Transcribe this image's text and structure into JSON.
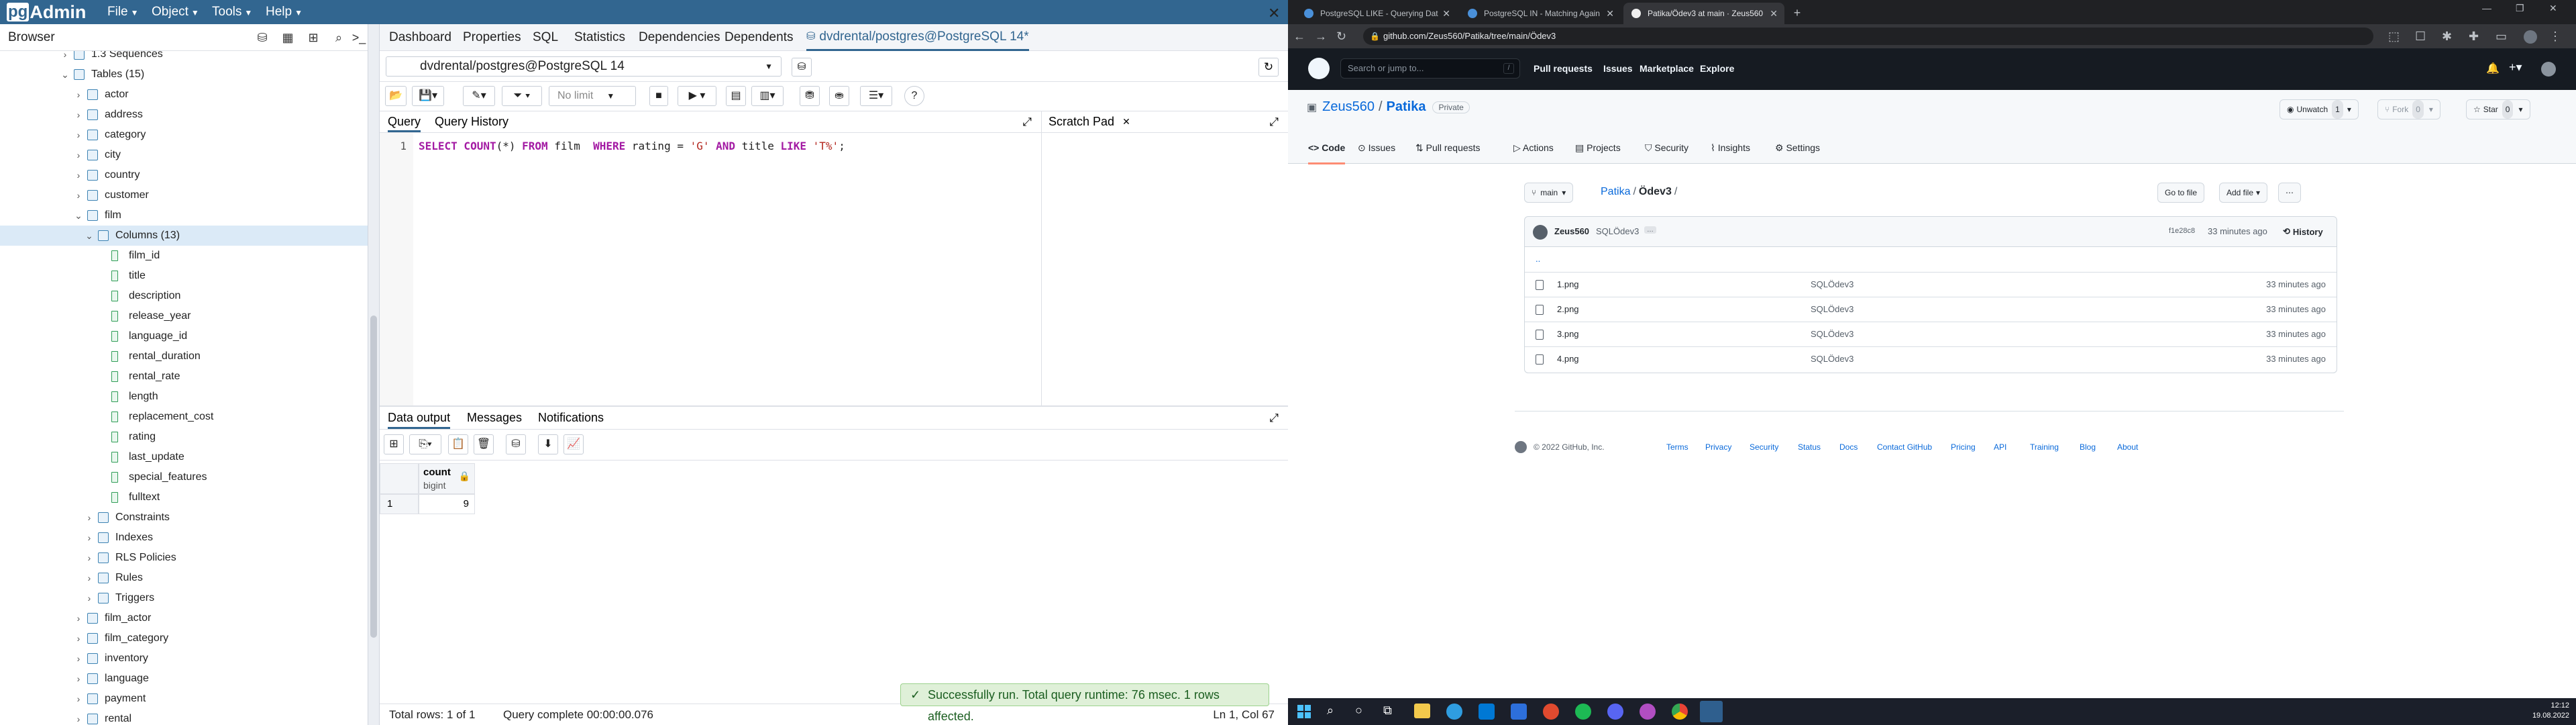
{
  "pgadmin": {
    "logo": {
      "pg": "pg",
      "rest": "Admin"
    },
    "menus": [
      "File",
      "Object",
      "Tools",
      "Help"
    ],
    "browser_title": "Browser",
    "tree": [
      {
        "label": "1.3 Sequences",
        "indent": 1,
        "icon": "sequence-icon",
        "expanded": false
      },
      {
        "label": "Tables (15)",
        "indent": 1,
        "icon": "tables-icon",
        "expanded": true
      },
      {
        "label": "actor",
        "indent": 2,
        "icon": "table-icon",
        "expanded": false
      },
      {
        "label": "address",
        "indent": 2,
        "icon": "table-icon",
        "expanded": false
      },
      {
        "label": "category",
        "indent": 2,
        "icon": "table-icon",
        "expanded": false
      },
      {
        "label": "city",
        "indent": 2,
        "icon": "table-icon",
        "expanded": false
      },
      {
        "label": "country",
        "indent": 2,
        "icon": "table-icon",
        "expanded": false
      },
      {
        "label": "customer",
        "indent": 2,
        "icon": "table-icon",
        "expanded": false
      },
      {
        "label": "film",
        "indent": 2,
        "icon": "table-icon",
        "expanded": true
      },
      {
        "label": "Columns (13)",
        "indent": 3,
        "icon": "columns-icon",
        "expanded": true,
        "selected": true
      },
      {
        "label": "film_id",
        "indent": 4,
        "icon": "column-icon"
      },
      {
        "label": "title",
        "indent": 4,
        "icon": "column-icon"
      },
      {
        "label": "description",
        "indent": 4,
        "icon": "column-icon"
      },
      {
        "label": "release_year",
        "indent": 4,
        "icon": "column-icon"
      },
      {
        "label": "language_id",
        "indent": 4,
        "icon": "column-icon"
      },
      {
        "label": "rental_duration",
        "indent": 4,
        "icon": "column-icon"
      },
      {
        "label": "rental_rate",
        "indent": 4,
        "icon": "column-icon"
      },
      {
        "label": "length",
        "indent": 4,
        "icon": "column-icon"
      },
      {
        "label": "replacement_cost",
        "indent": 4,
        "icon": "column-icon"
      },
      {
        "label": "rating",
        "indent": 4,
        "icon": "column-icon"
      },
      {
        "label": "last_update",
        "indent": 4,
        "icon": "column-icon"
      },
      {
        "label": "special_features",
        "indent": 4,
        "icon": "column-icon"
      },
      {
        "label": "fulltext",
        "indent": 4,
        "icon": "column-icon"
      },
      {
        "label": "Constraints",
        "indent": 3,
        "icon": "constraints-icon",
        "expanded": false
      },
      {
        "label": "Indexes",
        "indent": 3,
        "icon": "indexes-icon",
        "expanded": false
      },
      {
        "label": "RLS Policies",
        "indent": 3,
        "icon": "rls-icon",
        "expanded": false
      },
      {
        "label": "Rules",
        "indent": 3,
        "icon": "rules-icon",
        "expanded": false
      },
      {
        "label": "Triggers",
        "indent": 3,
        "icon": "triggers-icon",
        "expanded": false
      },
      {
        "label": "film_actor",
        "indent": 2,
        "icon": "table-icon",
        "expanded": false
      },
      {
        "label": "film_category",
        "indent": 2,
        "icon": "table-icon",
        "expanded": false
      },
      {
        "label": "inventory",
        "indent": 2,
        "icon": "table-icon",
        "expanded": false
      },
      {
        "label": "language",
        "indent": 2,
        "icon": "table-icon",
        "expanded": false
      },
      {
        "label": "payment",
        "indent": 2,
        "icon": "table-icon",
        "expanded": false
      },
      {
        "label": "rental",
        "indent": 2,
        "icon": "table-icon",
        "expanded": false
      }
    ],
    "tabs": [
      "Dashboard",
      "Properties",
      "SQL",
      "Statistics",
      "Dependencies",
      "Dependents"
    ],
    "query_tab_title": "dvdrental/postgres@PostgreSQL 14*",
    "connection": "dvdrental/postgres@PostgreSQL 14",
    "limit": "No limit",
    "query_tabs": {
      "query": "Query",
      "history": "Query History",
      "scratch": "Scratch Pad"
    },
    "line_number": "1",
    "sql": {
      "p1": "SELECT COUNT",
      "p2": "(*) ",
      "p3": "FROM",
      "p4": " film  ",
      "p5": "WHERE",
      "p6": " rating = ",
      "p7": "'G'",
      "p8": " ",
      "p9": "AND",
      "p10": " title ",
      "p11": "LIKE",
      "p12": " ",
      "p13": "'T%'",
      "p14": ";"
    },
    "output_tabs": [
      "Data output",
      "Messages",
      "Notifications"
    ],
    "grid": {
      "col_name": "count",
      "col_type": "bigint",
      "row_num": "1",
      "value": "9"
    },
    "status": {
      "rows": "Total rows: 1 of 1",
      "complete": "Query complete 00:00:00.076",
      "position": "Ln 1, Col 67"
    },
    "toast": "Successfully run. Total query runtime: 76 msec. 1 rows affected."
  },
  "chrome": {
    "tabs": [
      {
        "title": "PostgreSQL LIKE - Querying Dat",
        "active": false
      },
      {
        "title": "PostgreSQL IN - Matching Again",
        "active": false
      },
      {
        "title": "Patika/Ödev3 at main · Zeus560",
        "active": true
      }
    ],
    "url_host": "github.com",
    "url_path": "/Zeus560/Patika/tree/main/Ödev3"
  },
  "github": {
    "search_placeholder": "Search or jump to...",
    "search_key": "/",
    "nav": [
      "Pull requests",
      "Issues",
      "Marketplace",
      "Explore"
    ],
    "owner": "Zeus560",
    "repo": "Patika",
    "visibility": "Private",
    "unwatch": "Unwatch",
    "unwatch_count": "1",
    "fork": "Fork",
    "fork_count": "0",
    "star": "Star",
    "star_count": "0",
    "repo_tabs": [
      "Code",
      "Issues",
      "Pull requests",
      "Actions",
      "Projects",
      "Security",
      "Insights",
      "Settings"
    ],
    "branch": "main",
    "breadcrumb_repo": "Patika",
    "breadcrumb_dir": "Ödev3",
    "go_to_file": "Go to file",
    "add_file": "Add file",
    "commit_user": "Zeus560",
    "commit_msg": "SQLÖdev3",
    "commit_hash": "f1e28c8",
    "commit_time": "33 minutes ago",
    "history": "History",
    "parent_dir": "..",
    "files": [
      {
        "name": "1.png",
        "commit": "SQLÖdev3",
        "time": "33 minutes ago"
      },
      {
        "name": "2.png",
        "commit": "SQLÖdev3",
        "time": "33 minutes ago"
      },
      {
        "name": "3.png",
        "commit": "SQLÖdev3",
        "time": "33 minutes ago"
      },
      {
        "name": "4.png",
        "commit": "SQLÖdev3",
        "time": "33 minutes ago"
      }
    ],
    "footer_copy": "© 2022 GitHub, Inc.",
    "footer_links": [
      "Terms",
      "Privacy",
      "Security",
      "Status",
      "Docs",
      "Contact GitHub",
      "Pricing",
      "API",
      "Training",
      "Blog",
      "About"
    ]
  },
  "taskbar": {
    "time": "12:12",
    "date": "19.08.2022"
  }
}
